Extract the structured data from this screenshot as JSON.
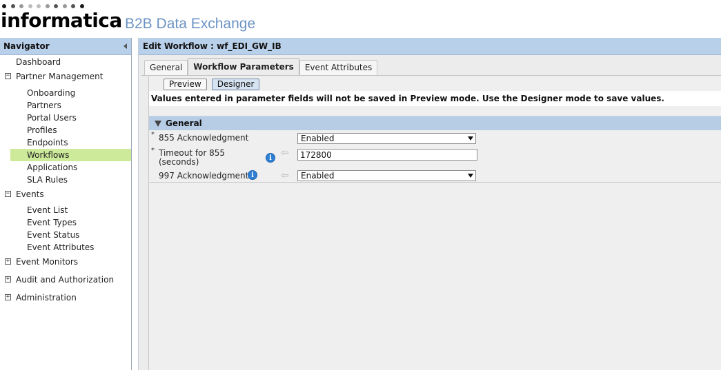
{
  "header": {
    "logo_text": "informatica",
    "product_name": "B2B Data Exchange",
    "dot_colors": [
      "#1a1a1a",
      "#555555",
      "#9a9a9a",
      "#bdbdbd",
      "#bdbdbd",
      "#9a9a9a",
      "#555555",
      "#9a9a9a",
      "#555555",
      "#1a1a1a"
    ]
  },
  "navigator": {
    "title": "Navigator",
    "items": [
      {
        "label": "Dashboard",
        "level": 0,
        "toggle": ""
      },
      {
        "label": "Partner Management",
        "level": 0,
        "toggle": "⊟"
      },
      {
        "label": "Onboarding",
        "level": 1
      },
      {
        "label": "Partners",
        "level": 1
      },
      {
        "label": "Portal Users",
        "level": 1
      },
      {
        "label": "Profiles",
        "level": 1
      },
      {
        "label": "Endpoints",
        "level": 1
      },
      {
        "label": "Workflows",
        "level": 1,
        "selected": true
      },
      {
        "label": "Applications",
        "level": 1
      },
      {
        "label": "SLA Rules",
        "level": 1
      },
      {
        "label": "Events",
        "level": 0,
        "toggle": "⊟"
      },
      {
        "label": "Event List",
        "level": 1
      },
      {
        "label": "Event Types",
        "level": 1
      },
      {
        "label": "Event Status",
        "level": 1
      },
      {
        "label": "Event Attributes",
        "level": 1
      },
      {
        "label": "Event Monitors",
        "level": 0,
        "toggle": "⊞"
      },
      {
        "label": "Audit and Authorization",
        "level": 0,
        "toggle": "⊞"
      },
      {
        "label": "Administration",
        "level": 0,
        "toggle": "⊞"
      }
    ]
  },
  "main": {
    "title": "Edit Workflow : wf_EDI_GW_IB",
    "tabs": [
      {
        "label": "General",
        "active": false
      },
      {
        "label": "Workflow Parameters",
        "active": true
      },
      {
        "label": "Event Attributes",
        "active": false
      }
    ],
    "mode_buttons": {
      "preview": "Preview",
      "designer": "Designer"
    },
    "notice": "Values entered in parameter fields will not be saved in Preview mode. Use the Designer mode to save values.",
    "section": {
      "title": "General",
      "fields": [
        {
          "required": "*",
          "label": "855 Acknowledgment",
          "type": "select",
          "value": "Enabled"
        },
        {
          "required": "*",
          "label_line1": "Timeout for 855",
          "label_line2": "(seconds)",
          "type": "text",
          "value": "172800",
          "info": "i"
        },
        {
          "required": "",
          "label": "997 Acknowledgment",
          "type": "select",
          "value": "Enabled",
          "info": "i"
        }
      ]
    }
  },
  "colors": {
    "header_bar": "#b9d0ea",
    "selected_nav": "#cde99a",
    "product_text": "#6b93c4",
    "info_icon": "#2f7fd4"
  }
}
